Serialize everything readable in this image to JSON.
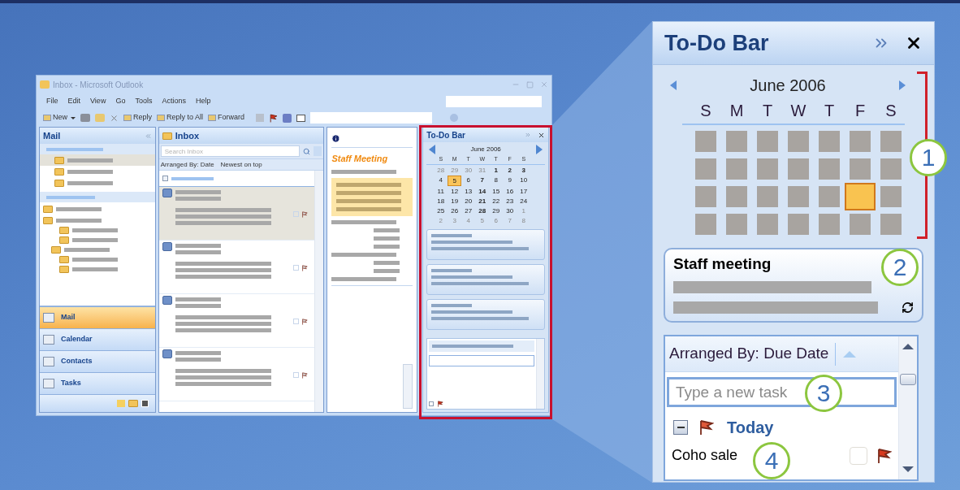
{
  "outlook_window": {
    "title": "Inbox - Microsoft Outlook",
    "menu": [
      "File",
      "Edit",
      "View",
      "Go",
      "Tools",
      "Actions",
      "Help"
    ],
    "toolbar": [
      {
        "kind": "split",
        "label": "New"
      },
      {
        "kind": "reply",
        "label": "Reply"
      },
      {
        "kind": "reply",
        "label": "Reply to All"
      },
      {
        "kind": "forward",
        "label": "Forward"
      }
    ],
    "nav_pane": {
      "title": "Mail",
      "buttons": [
        {
          "label": "Mail",
          "selected": true
        },
        {
          "label": "Calendar",
          "selected": false
        },
        {
          "label": "Contacts",
          "selected": false
        },
        {
          "label": "Tasks",
          "selected": false
        }
      ]
    },
    "inbox": {
      "title": "Inbox",
      "search_placeholder": "Search Inbox",
      "arranged_by": "Arranged By: Date",
      "sort_order": "Newest on top",
      "messages": [
        {
          "selected": true
        },
        {
          "selected": false
        },
        {
          "selected": false
        },
        {
          "selected": false
        }
      ]
    },
    "reading_pane": {
      "subject": "Staff Meeting"
    },
    "todo_bar": {
      "title": "To-Do Bar",
      "month": "June 2006",
      "weekdays": [
        "S",
        "M",
        "T",
        "W",
        "T",
        "F",
        "S"
      ],
      "days": [
        {
          "day": "28",
          "muted": true,
          "bold": false,
          "selected": false
        },
        {
          "day": "29",
          "muted": true,
          "bold": false,
          "selected": false
        },
        {
          "day": "30",
          "muted": true,
          "bold": false,
          "selected": false
        },
        {
          "day": "31",
          "muted": true,
          "bold": false,
          "selected": false
        },
        {
          "day": "1",
          "muted": false,
          "bold": true,
          "selected": false
        },
        {
          "day": "2",
          "muted": false,
          "bold": true,
          "selected": false
        },
        {
          "day": "3",
          "muted": false,
          "bold": true,
          "selected": false
        },
        {
          "day": "4",
          "muted": false,
          "bold": false,
          "selected": false
        },
        {
          "day": "5",
          "muted": false,
          "bold": false,
          "selected": true
        },
        {
          "day": "6",
          "muted": false,
          "bold": false,
          "selected": false
        },
        {
          "day": "7",
          "muted": false,
          "bold": true,
          "selected": false
        },
        {
          "day": "8",
          "muted": false,
          "bold": false,
          "selected": false
        },
        {
          "day": "9",
          "muted": false,
          "bold": false,
          "selected": false
        },
        {
          "day": "10",
          "muted": false,
          "bold": false,
          "selected": false
        },
        {
          "day": "11",
          "muted": false,
          "bold": false,
          "selected": false
        },
        {
          "day": "12",
          "muted": false,
          "bold": false,
          "selected": false
        },
        {
          "day": "13",
          "muted": false,
          "bold": false,
          "selected": false
        },
        {
          "day": "14",
          "muted": false,
          "bold": true,
          "selected": false
        },
        {
          "day": "15",
          "muted": false,
          "bold": false,
          "selected": false
        },
        {
          "day": "16",
          "muted": false,
          "bold": false,
          "selected": false
        },
        {
          "day": "17",
          "muted": false,
          "bold": false,
          "selected": false
        },
        {
          "day": "18",
          "muted": false,
          "bold": false,
          "selected": false
        },
        {
          "day": "19",
          "muted": false,
          "bold": false,
          "selected": false
        },
        {
          "day": "20",
          "muted": false,
          "bold": false,
          "selected": false
        },
        {
          "day": "21",
          "muted": false,
          "bold": true,
          "selected": false
        },
        {
          "day": "22",
          "muted": false,
          "bold": false,
          "selected": false
        },
        {
          "day": "23",
          "muted": false,
          "bold": false,
          "selected": false
        },
        {
          "day": "24",
          "muted": false,
          "bold": false,
          "selected": false
        },
        {
          "day": "25",
          "muted": false,
          "bold": false,
          "selected": false
        },
        {
          "day": "26",
          "muted": false,
          "bold": false,
          "selected": false
        },
        {
          "day": "27",
          "muted": false,
          "bold": false,
          "selected": false
        },
        {
          "day": "28",
          "muted": false,
          "bold": true,
          "selected": false
        },
        {
          "day": "29",
          "muted": false,
          "bold": false,
          "selected": false
        },
        {
          "day": "30",
          "muted": false,
          "bold": false,
          "selected": false
        },
        {
          "day": "1",
          "muted": true,
          "bold": false,
          "selected": false
        },
        {
          "day": "2",
          "muted": true,
          "bold": false,
          "selected": false
        },
        {
          "day": "3",
          "muted": true,
          "bold": false,
          "selected": false
        },
        {
          "day": "4",
          "muted": true,
          "bold": false,
          "selected": false
        },
        {
          "day": "5",
          "muted": true,
          "bold": false,
          "selected": false
        },
        {
          "day": "6",
          "muted": true,
          "bold": false,
          "selected": false
        },
        {
          "day": "7",
          "muted": true,
          "bold": false,
          "selected": false
        },
        {
          "day": "8",
          "muted": true,
          "bold": false,
          "selected": false
        }
      ]
    }
  },
  "todo_bar_zoom": {
    "title": "To-Do Bar",
    "month": "June 2006",
    "weekdays": [
      "S",
      "M",
      "T",
      "W",
      "T",
      "F",
      "S"
    ],
    "cells": [
      {
        "selected": false
      },
      {
        "selected": false
      },
      {
        "selected": false
      },
      {
        "selected": false
      },
      {
        "selected": false
      },
      {
        "selected": false
      },
      {
        "selected": false
      },
      {
        "selected": false
      },
      {
        "selected": false
      },
      {
        "selected": false
      },
      {
        "selected": false
      },
      {
        "selected": false
      },
      {
        "selected": false
      },
      {
        "selected": false
      },
      {
        "selected": false
      },
      {
        "selected": false
      },
      {
        "selected": false
      },
      {
        "selected": false
      },
      {
        "selected": false
      },
      {
        "selected": true
      },
      {
        "selected": false
      },
      {
        "selected": false
      },
      {
        "selected": false
      },
      {
        "selected": false
      },
      {
        "selected": false
      },
      {
        "selected": false
      },
      {
        "selected": false
      },
      {
        "selected": false
      }
    ],
    "appointment": {
      "title": "Staff meeting"
    },
    "tasks": {
      "arranged_by": "Arranged By: Due Date",
      "placeholder": "Type a new task",
      "group": "Today",
      "items": [
        {
          "name": "Coho sale",
          "checked": false
        }
      ]
    }
  },
  "callouts": [
    "1",
    "2",
    "3",
    "4"
  ]
}
